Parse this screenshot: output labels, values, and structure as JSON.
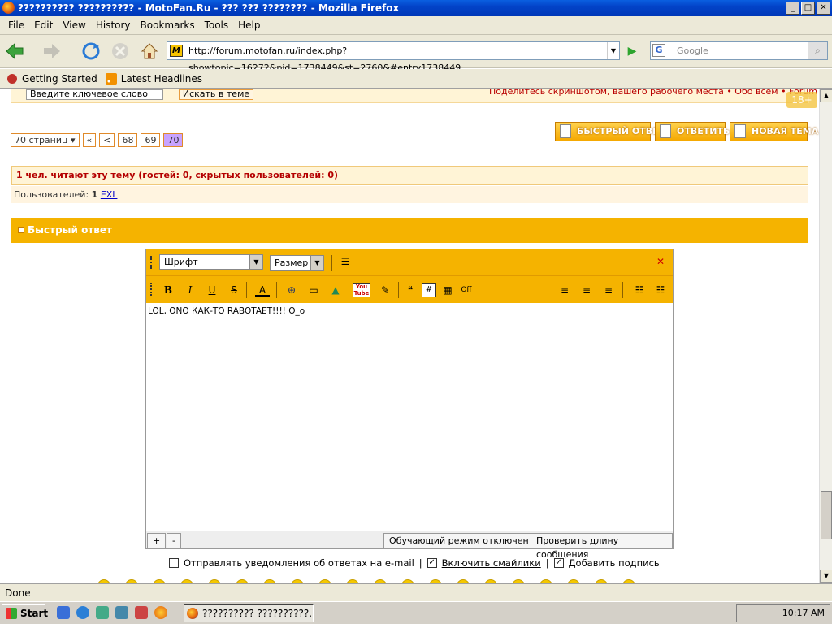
{
  "window": {
    "title": "?????????? ?????????? - MotoFan.Ru - ??? ??? ???????? - Mozilla Firefox",
    "buttons": {
      "minimize": "_",
      "maximize": "□",
      "close": "✕"
    }
  },
  "menu": [
    "File",
    "Edit",
    "View",
    "History",
    "Bookmarks",
    "Tools",
    "Help"
  ],
  "nav": {
    "url": "http://forum.motofan.ru/index.php?showtopic=16272&pid=1738449&st=2760&#entry1738449",
    "search_placeholder": "Google"
  },
  "bookmarks": [
    "Getting Started",
    "Latest Headlines"
  ],
  "forum": {
    "keyword_input": "Введите ключевое слово",
    "search_topic_btn": "Искать в теме",
    "share_link": "Поделитесь скриншотом, вашего рабочего места • Обо всём • Forum",
    "age_badge": "18+",
    "pager": {
      "pages_label": "70 страниц ▾",
      "first": "«",
      "prev": "<",
      "p68": "68",
      "p69": "69",
      "current": "70"
    },
    "buttons": {
      "quick_reply": "БЫСТРЫЙ ОТВЕТ",
      "reply": "ОТВЕТИТЬ",
      "new_topic": "НОВАЯ ТЕМА"
    },
    "readers": "1 чел. читают эту тему (гостей: 0, скрытых пользователей: 0)",
    "users_label": "Пользователей:",
    "users_count": "1",
    "user_name": "EXL",
    "quick_reply_title": "Быстрый ответ"
  },
  "editor": {
    "font_select": "Шрифт",
    "size_select": "Размер",
    "text": "LOL, ONO КАК-ТО RABOTAET!!!! O_o",
    "plus": "+",
    "minus": "-",
    "training_mode": "Обучающий режим отключен",
    "check_length": "Проверить длину сообщения"
  },
  "options": {
    "notify": "Отправлять уведомления об ответах на e-mail",
    "smilies": "Включить смайлики",
    "signature": "Добавить подпись",
    "separator": "|"
  },
  "status": "Done",
  "taskbar": {
    "start": "Start",
    "task_item": "?????????? ??????????...",
    "clock": "10:17 AM"
  }
}
